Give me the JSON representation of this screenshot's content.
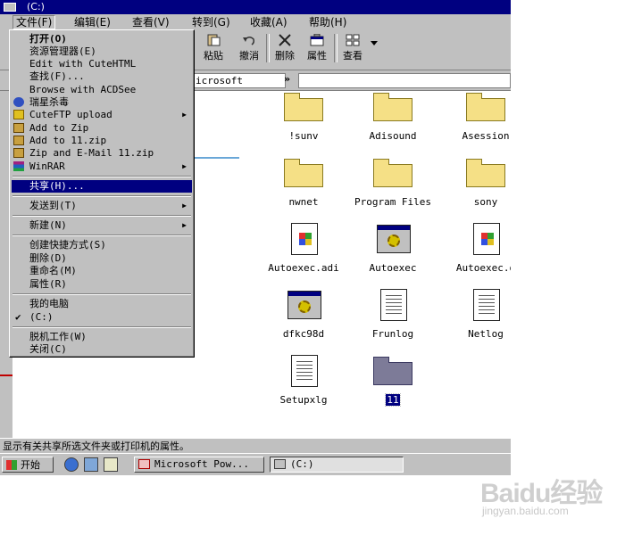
{
  "window": {
    "title": "(C:)"
  },
  "menubar": {
    "items": [
      {
        "label": "文件(F)"
      },
      {
        "label": "编辑(E)"
      },
      {
        "label": "查看(V)"
      },
      {
        "label": "转到(G)"
      },
      {
        "label": "收藏(A)"
      },
      {
        "label": "帮助(H)"
      }
    ]
  },
  "toolbar": {
    "paste": "粘贴",
    "undo": "撤消",
    "delete": "删除",
    "properties": "属性",
    "view": "查看"
  },
  "address": {
    "value": "icrosoft",
    "chevron": "»"
  },
  "file_menu": {
    "items": [
      {
        "label": "打开(O)",
        "bold": true
      },
      {
        "label": "资源管理器(E)"
      },
      {
        "label": "Edit with CuteHTML"
      },
      {
        "label": "查找(F)..."
      },
      {
        "label": "Browse with ACDSee"
      },
      {
        "label": "瑞星杀毒",
        "icon": "rising-antivirus-icon"
      },
      {
        "label": "CuteFTP upload",
        "icon": "cuteftp-icon",
        "submenu": true
      },
      {
        "label": "Add to Zip",
        "icon": "winzip-icon"
      },
      {
        "label": "Add to 11.zip",
        "icon": "winzip-icon"
      },
      {
        "label": "Zip and E-Mail 11.zip",
        "icon": "winzip-icon"
      },
      {
        "label": "WinRAR",
        "icon": "winrar-icon",
        "submenu": true
      },
      {
        "label": "共享(H)...",
        "highlighted": true
      },
      {
        "label": "发送到(T)",
        "submenu": true
      },
      {
        "label": "新建(N)",
        "submenu": true
      },
      {
        "label": "创建快捷方式(S)"
      },
      {
        "label": "删除(D)"
      },
      {
        "label": "重命名(M)"
      },
      {
        "label": "属性(R)"
      },
      {
        "label": "我的电脑"
      },
      {
        "label": "(C:)",
        "checked": true
      },
      {
        "label": "脱机工作(W)"
      },
      {
        "label": "关闭(C)"
      }
    ]
  },
  "files": [
    {
      "name": "!sunv",
      "type": "folder"
    },
    {
      "name": "Adisound",
      "type": "folder"
    },
    {
      "name": "Asession",
      "type": "folder"
    },
    {
      "name": "nwnet",
      "type": "folder"
    },
    {
      "name": "Program Files",
      "type": "folder"
    },
    {
      "name": "sony",
      "type": "folder"
    },
    {
      "name": "Autoexec.adi",
      "type": "windows-file"
    },
    {
      "name": "Autoexec",
      "type": "app"
    },
    {
      "name": "Autoexec.o",
      "type": "windows-file"
    },
    {
      "name": "dfkc98d",
      "type": "app"
    },
    {
      "name": "Frunlog",
      "type": "text"
    },
    {
      "name": "Netlog",
      "type": "text"
    },
    {
      "name": "Setupxlg",
      "type": "text"
    },
    {
      "name": "11",
      "type": "folder-selected"
    }
  ],
  "statusbar": {
    "text": "显示有关共享所选文件夹或打印机的属性。"
  },
  "taskbar": {
    "start": "开始",
    "tasks": [
      {
        "label": "Microsoft Pow..."
      },
      {
        "label": "(C:)"
      }
    ]
  },
  "watermark": {
    "logo": "Baidu经验",
    "sub": "jingyan.baidu.com"
  }
}
